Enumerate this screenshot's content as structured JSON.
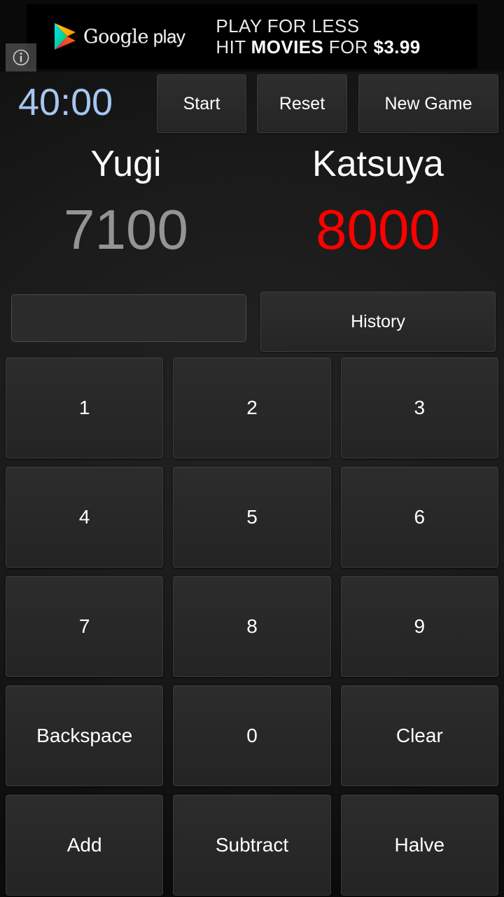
{
  "ad": {
    "brand": "Google",
    "brand_suffix": " play",
    "line1": "PLAY FOR LESS",
    "line2_pre": "HIT ",
    "line2_bold1": "MOVIES",
    "line2_mid": " FOR ",
    "line2_bold2": "$3.99",
    "info_icon": "info-icon"
  },
  "timer": {
    "value": "40:00",
    "color": "#a5c6f0",
    "start_label": "Start",
    "reset_label": "Reset",
    "new_game_label": "New Game"
  },
  "players": [
    {
      "name": "Yugi",
      "score": "7100",
      "state": "inactive",
      "color": "#949494"
    },
    {
      "name": "Katsuya",
      "score": "8000",
      "state": "active",
      "color": "#ff0000"
    }
  ],
  "input": {
    "value": "",
    "placeholder": ""
  },
  "history": {
    "label": "History"
  },
  "keypad": [
    {
      "label": "1",
      "name": "key-1"
    },
    {
      "label": "2",
      "name": "key-2"
    },
    {
      "label": "3",
      "name": "key-3"
    },
    {
      "label": "4",
      "name": "key-4"
    },
    {
      "label": "5",
      "name": "key-5"
    },
    {
      "label": "6",
      "name": "key-6"
    },
    {
      "label": "7",
      "name": "key-7"
    },
    {
      "label": "8",
      "name": "key-8"
    },
    {
      "label": "9",
      "name": "key-9"
    },
    {
      "label": "Backspace",
      "name": "key-backspace"
    },
    {
      "label": "0",
      "name": "key-0"
    },
    {
      "label": "Clear",
      "name": "key-clear"
    },
    {
      "label": "Add",
      "name": "key-add"
    },
    {
      "label": "Subtract",
      "name": "key-subtract"
    },
    {
      "label": "Halve",
      "name": "key-halve"
    }
  ]
}
